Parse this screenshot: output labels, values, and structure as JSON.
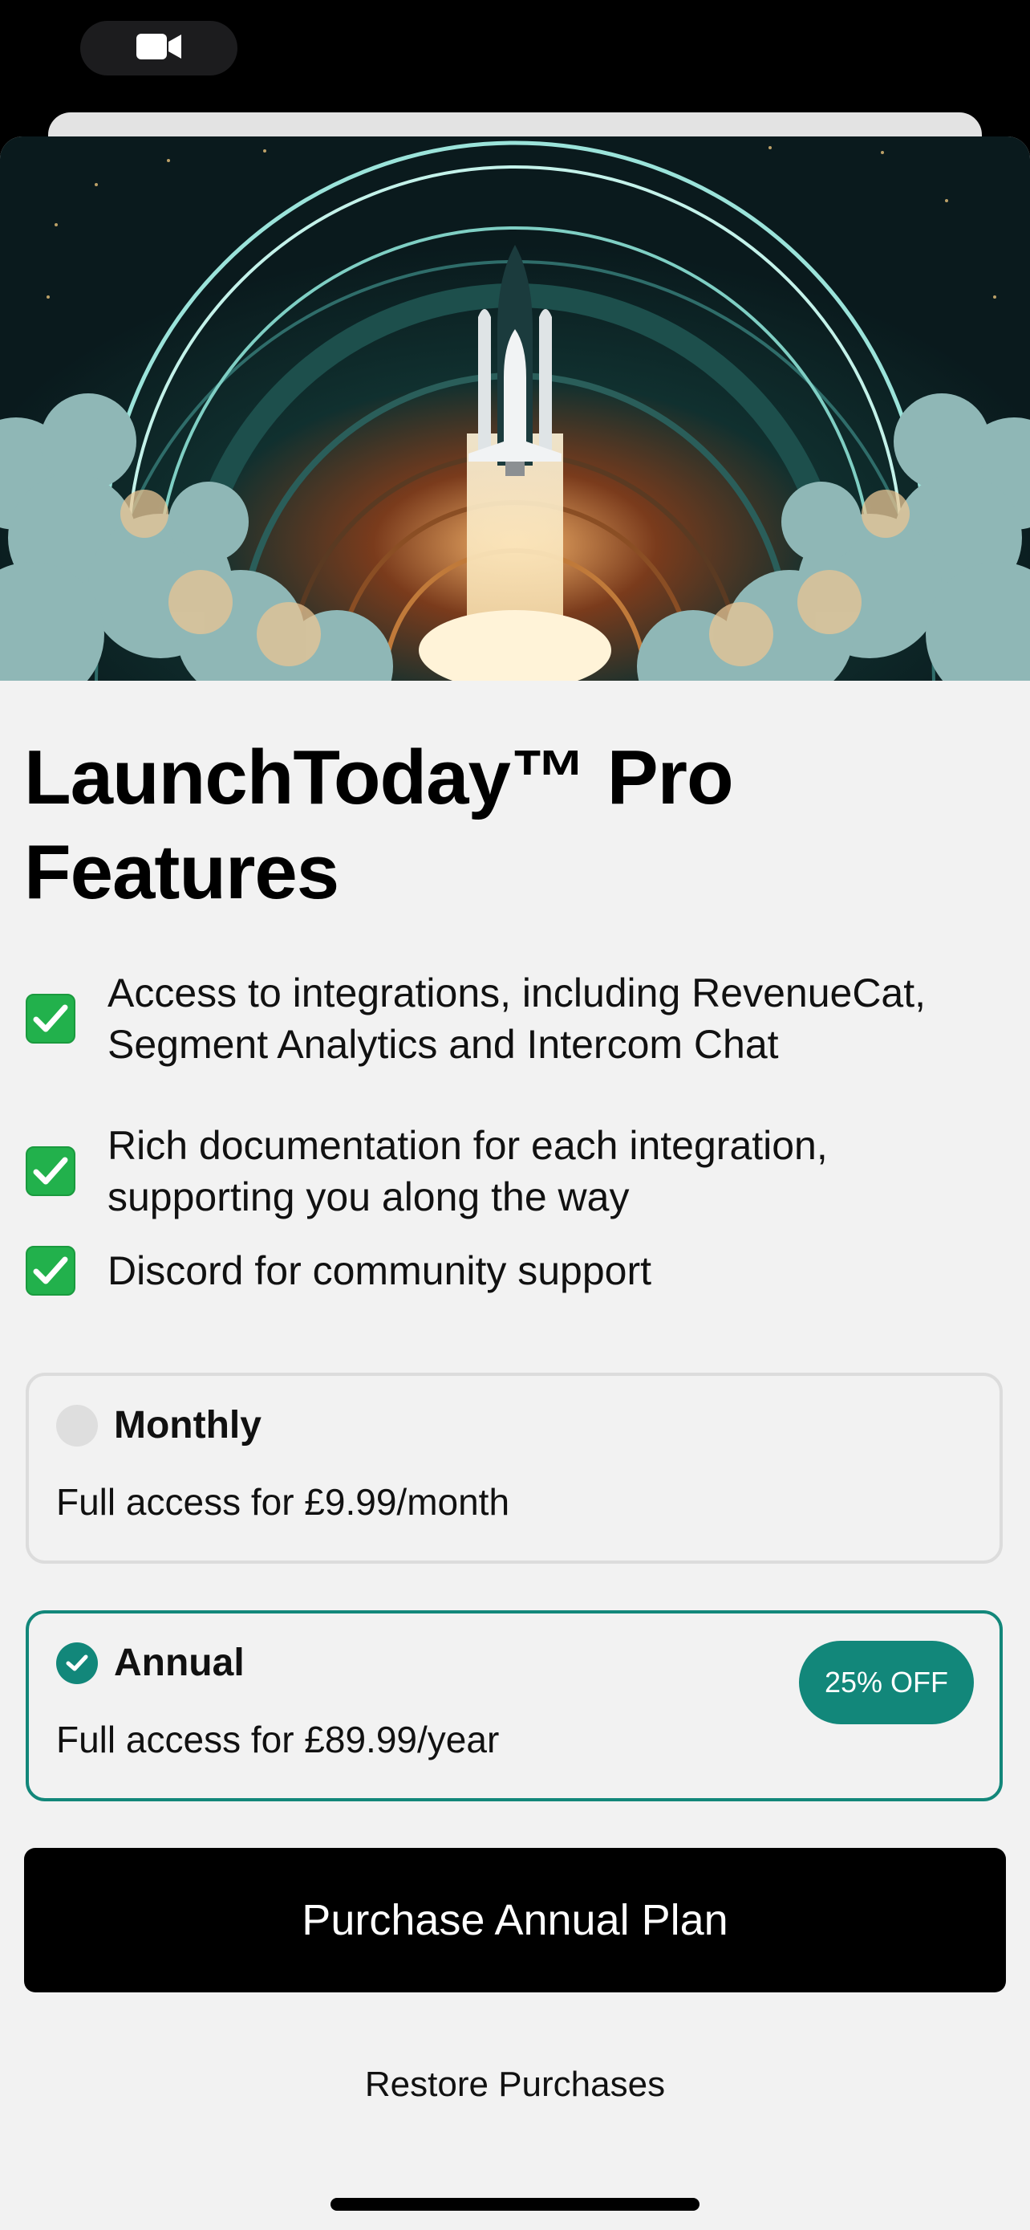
{
  "status_bar": {
    "icon": "video-camera-icon"
  },
  "paywall": {
    "hero_image": "rocket-launch-illustration",
    "title": "LaunchToday™ Pro Features",
    "features": [
      {
        "icon": "green-check-box-icon",
        "text": "Access to integrations, including RevenueCat, Segment Analytics and Intercom Chat"
      },
      {
        "icon": "green-check-box-icon",
        "text": "Rich documentation for each integration, supporting you along the way"
      },
      {
        "icon": "green-check-box-icon",
        "text": "Discord for community support"
      }
    ],
    "plans": [
      {
        "name": "Monthly",
        "description": "Full access for £9.99/month",
        "selected": false
      },
      {
        "name": "Annual",
        "description": "Full access for £89.99/year",
        "selected": true,
        "badge": "25% OFF"
      }
    ],
    "purchase_button": "Purchase Annual Plan",
    "restore_link": "Restore Purchases"
  },
  "colors": {
    "accent": "#12877a",
    "check_green": "#22b14c",
    "background": "#f2f2f2",
    "button": "#000000"
  }
}
